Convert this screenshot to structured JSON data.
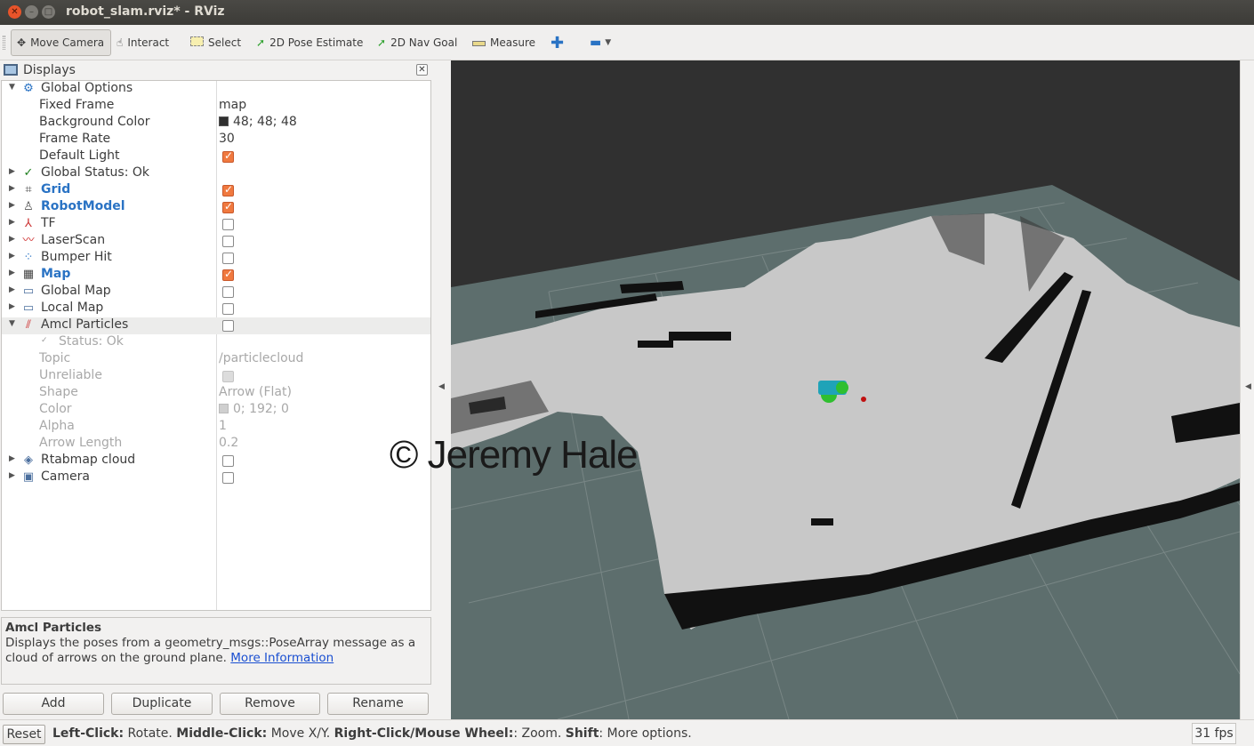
{
  "window": {
    "title": "robot_slam.rviz* - RViz"
  },
  "toolbar": {
    "move_camera": "Move Camera",
    "interact": "Interact",
    "select": "Select",
    "pose_estimate": "2D Pose Estimate",
    "nav_goal": "2D Nav Goal",
    "measure": "Measure"
  },
  "panel": {
    "title": "Displays"
  },
  "tree": {
    "global_options": "Global Options",
    "fixed_frame_label": "Fixed Frame",
    "fixed_frame_value": "map",
    "bg_color_label": "Background Color",
    "bg_color_value": "48; 48; 48",
    "frame_rate_label": "Frame Rate",
    "frame_rate_value": "30",
    "default_light_label": "Default Light",
    "global_status": "Global Status: Ok",
    "grid": "Grid",
    "robot_model": "RobotModel",
    "tf": "TF",
    "laser_scan": "LaserScan",
    "bumper_hit": "Bumper Hit",
    "map": "Map",
    "global_map": "Global Map",
    "local_map": "Local Map",
    "amcl_particles": "Amcl Particles",
    "status_ok": "Status: Ok",
    "topic_label": "Topic",
    "topic_value": "/particlecloud",
    "unreliable_label": "Unreliable",
    "shape_label": "Shape",
    "shape_value": "Arrow (Flat)",
    "color_label": "Color",
    "color_value": "0; 192; 0",
    "alpha_label": "Alpha",
    "alpha_value": "1",
    "arrow_length_label": "Arrow Length",
    "arrow_length_value": "0.2",
    "rtabmap_cloud": "Rtabmap cloud",
    "camera": "Camera"
  },
  "description": {
    "title": "Amcl Particles",
    "text": "Displays the poses from a geometry_msgs::PoseArray message as a cloud of arrows on the ground plane.",
    "link": "More Information"
  },
  "buttons": {
    "add": "Add",
    "duplicate": "Duplicate",
    "remove": "Remove",
    "rename": "Rename"
  },
  "watermark": "© Jeremy Hale",
  "status": {
    "reset": "Reset",
    "left_click": "Left-Click:",
    "left_click_desc": " Rotate. ",
    "middle_click": "Middle-Click:",
    "middle_click_desc": " Move X/Y. ",
    "right_click": "Right-Click/Mouse Wheel:",
    "right_click_desc": ": Zoom. ",
    "shift": "Shift",
    "shift_desc": ": More options.",
    "fps": "31 fps"
  },
  "colors": {
    "background": "#303030",
    "checkbox_on": "#f0793f",
    "link": "#1a4fd1",
    "map_free": "#c8c8c8",
    "map_unknown": "#5d6f6e"
  }
}
